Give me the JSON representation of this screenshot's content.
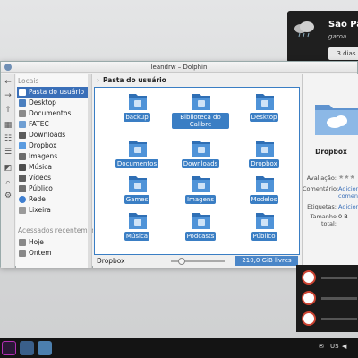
{
  "window": {
    "title": "leandrw – Dolphin"
  },
  "weather": {
    "city": "Sao Pa",
    "condition": "garoa",
    "tab": "3 dias"
  },
  "places": {
    "header": "Locais",
    "items": [
      {
        "label": "Pasta do usuário",
        "selected": true,
        "icon": "home-icon"
      },
      {
        "label": "Desktop",
        "icon": "desktop-icon"
      },
      {
        "label": "Documentos",
        "icon": "documents-icon"
      },
      {
        "label": "FATEC",
        "icon": "folder-icon"
      },
      {
        "label": "Downloads",
        "icon": "downloads-icon"
      },
      {
        "label": "Dropbox",
        "icon": "dropbox-icon"
      },
      {
        "label": "Imagens",
        "icon": "images-icon"
      },
      {
        "label": "Música",
        "icon": "music-icon"
      },
      {
        "label": "Vídeos",
        "icon": "videos-icon"
      },
      {
        "label": "Público",
        "icon": "public-icon"
      },
      {
        "label": "Rede",
        "icon": "network-icon"
      },
      {
        "label": "Lixeira",
        "icon": "trash-icon"
      }
    ],
    "recent_header": "Acessados recentemente",
    "recent": [
      {
        "label": "Hoje",
        "icon": "calendar-icon"
      },
      {
        "label": "Ontem",
        "icon": "calendar-icon"
      }
    ]
  },
  "breadcrumb": {
    "label": "Pasta do usuário"
  },
  "files": [
    {
      "label": "backup",
      "icon": "folder-icon"
    },
    {
      "label": "Biblioteca do Calibre",
      "icon": "folder-icon"
    },
    {
      "label": "Desktop",
      "icon": "desktop-folder-icon"
    },
    {
      "label": "Documentos",
      "icon": "documents-folder-icon"
    },
    {
      "label": "Downloads",
      "icon": "downloads-folder-icon"
    },
    {
      "label": "Dropbox",
      "icon": "dropbox-folder-icon"
    },
    {
      "label": "Games",
      "icon": "games-folder-icon"
    },
    {
      "label": "Imagens",
      "icon": "images-folder-icon"
    },
    {
      "label": "Modelos",
      "icon": "templates-folder-icon"
    },
    {
      "label": "Música",
      "icon": "music-folder-icon"
    },
    {
      "label": "Podcasts",
      "icon": "podcasts-folder-icon"
    },
    {
      "label": "Público",
      "icon": "public-folder-icon"
    }
  ],
  "status": {
    "current": "Dropbox",
    "free_space": "210,0 GiB livres"
  },
  "info": {
    "name": "Dropbox",
    "rating_label": "Avaliação:",
    "comment_label": "Comentário:",
    "comment_value": "Adicionar comentário",
    "tags_label": "Etiquetas:",
    "tags_value": "Adicionar",
    "size_label": "Tamanho total:",
    "size_value": "0 B"
  },
  "tray": {
    "keyboard_layout": "US"
  },
  "colors": {
    "accent": "#3a7ec4",
    "selection": "#3a6fb8"
  }
}
